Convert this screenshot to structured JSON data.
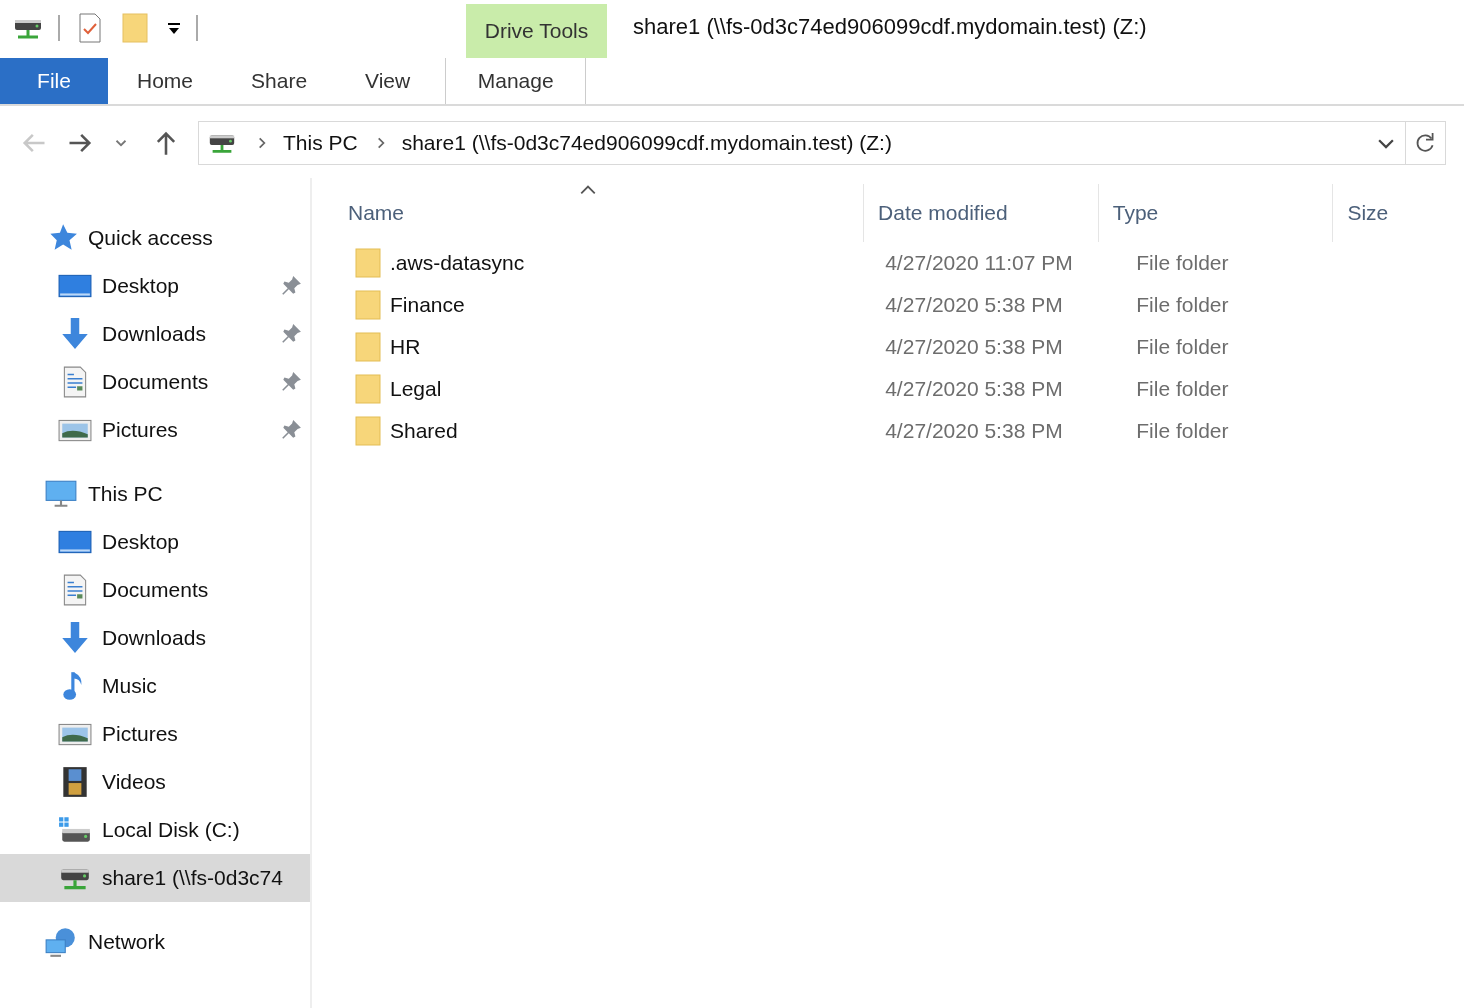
{
  "window": {
    "title": "share1 (\\\\fs-0d3c74ed906099cdf.mydomain.test) (Z:)"
  },
  "ribbon": {
    "contextual_group": "Drive Tools",
    "tabs": [
      {
        "label": "File",
        "kind": "file",
        "selected": false
      },
      {
        "label": "Home",
        "kind": "tab",
        "selected": false
      },
      {
        "label": "Share",
        "kind": "tab",
        "selected": false
      },
      {
        "label": "View",
        "kind": "tab",
        "selected": false
      },
      {
        "label": "Manage",
        "kind": "contextual",
        "selected": false
      }
    ]
  },
  "address_bar": {
    "breadcrumbs": [
      "This PC",
      "share1 (\\\\fs-0d3c74ed906099cdf.mydomain.test) (Z:)"
    ]
  },
  "navigation": [
    {
      "label": "Quick access",
      "kind": "quick",
      "selected": false,
      "children": [
        {
          "label": "Desktop",
          "kind": "desktop",
          "pinned": true,
          "selected": false
        },
        {
          "label": "Downloads",
          "kind": "downloads",
          "pinned": true,
          "selected": false
        },
        {
          "label": "Documents",
          "kind": "documents",
          "pinned": true,
          "selected": false
        },
        {
          "label": "Pictures",
          "kind": "pictures",
          "pinned": true,
          "selected": false
        }
      ]
    },
    {
      "label": "This PC",
      "kind": "pc",
      "selected": false,
      "children": [
        {
          "label": "Desktop",
          "kind": "desktop",
          "pinned": false,
          "selected": false
        },
        {
          "label": "Documents",
          "kind": "documents",
          "pinned": false,
          "selected": false
        },
        {
          "label": "Downloads",
          "kind": "downloads",
          "pinned": false,
          "selected": false
        },
        {
          "label": "Music",
          "kind": "music",
          "pinned": false,
          "selected": false
        },
        {
          "label": "Pictures",
          "kind": "pictures",
          "pinned": false,
          "selected": false
        },
        {
          "label": "Videos",
          "kind": "videos",
          "pinned": false,
          "selected": false
        },
        {
          "label": "Local Disk (C:)",
          "kind": "disk",
          "pinned": false,
          "selected": false
        },
        {
          "label": "share1 (\\\\fs-0d3c74",
          "kind": "netdrive",
          "pinned": false,
          "selected": true
        }
      ]
    },
    {
      "label": "Network",
      "kind": "network",
      "selected": false
    }
  ],
  "file_list": {
    "columns": [
      {
        "label": "Name",
        "sorted": true
      },
      {
        "label": "Date modified",
        "sorted": false
      },
      {
        "label": "Type",
        "sorted": false
      },
      {
        "label": "Size",
        "sorted": false
      }
    ],
    "rows": [
      {
        "name": ".aws-datasync",
        "date_modified": "4/27/2020 11:07 PM",
        "type": "File folder"
      },
      {
        "name": "Finance",
        "date_modified": "4/27/2020 5:38 PM",
        "type": "File folder"
      },
      {
        "name": "HR",
        "date_modified": "4/27/2020 5:38 PM",
        "type": "File folder"
      },
      {
        "name": "Legal",
        "date_modified": "4/27/2020 5:38 PM",
        "type": "File folder"
      },
      {
        "name": "Shared",
        "date_modified": "4/27/2020 5:38 PM",
        "type": "File folder"
      }
    ]
  }
}
